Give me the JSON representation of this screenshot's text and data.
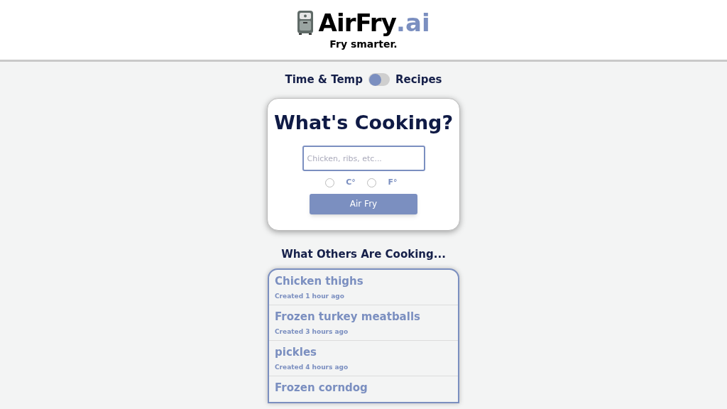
{
  "header": {
    "logo_name": "AirFry",
    "logo_suffix": ".ai",
    "tagline": "Fry smarter."
  },
  "mode_toggle": {
    "left_label": "Time & Temp",
    "right_label": "Recipes",
    "on": false
  },
  "search_card": {
    "title": "What's Cooking?",
    "input": {
      "placeholder": "Chicken, ribs, etc..."
    },
    "units": [
      {
        "label": "C°",
        "selected": false
      },
      {
        "label": "F°",
        "selected": false
      }
    ],
    "button": "Air Fry"
  },
  "recent": {
    "title": "What Others Are Cooking...",
    "items": [
      {
        "name": "Chicken thighs",
        "created": "Created 1 hour ago"
      },
      {
        "name": "Frozen turkey meatballs",
        "created": "Created 3 hours ago"
      },
      {
        "name": "pickles",
        "created": "Created 4 hours ago"
      },
      {
        "name": "Frozen corndog"
      }
    ]
  }
}
